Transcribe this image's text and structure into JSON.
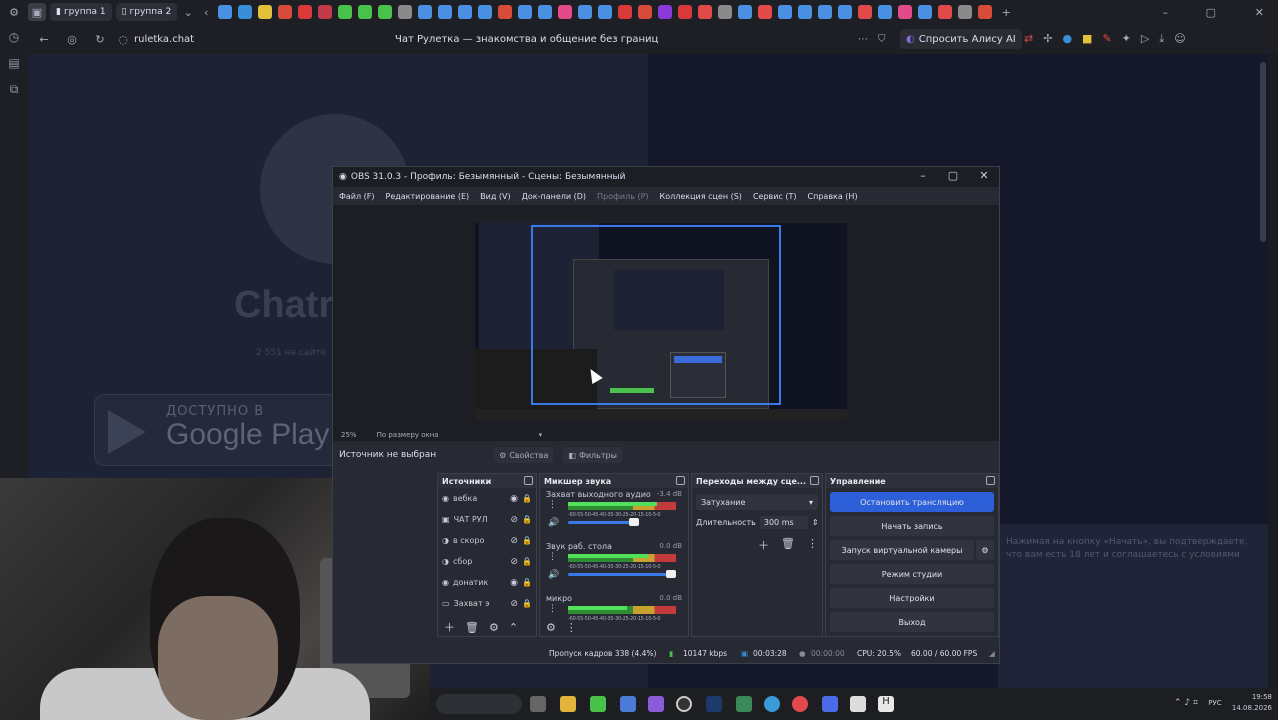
{
  "browser": {
    "tab_groups": [
      {
        "label": "группа 1"
      },
      {
        "label": "группа 2"
      }
    ],
    "url": "ruletka.chat",
    "page_title": "Чат Рулетка — знакомства и общение без границ",
    "alice_label": "Спросить Алису AI",
    "favicons": [
      "#4a90e2",
      "#3a8ed8",
      "#e2c23a",
      "#d84a3a",
      "#d83a3a",
      "#c23a4a",
      "#49c14b",
      "#49c14b",
      "#49c14b",
      "#8a8a8a",
      "#4a90e2",
      "#4a90e2",
      "#4a90e2",
      "#4a90e2",
      "#d84a3a",
      "#4a90e2",
      "#4a90e2",
      "#e24a8a",
      "#4a90e2",
      "#4a90e2",
      "#d83a3a",
      "#d84a3a",
      "#8a3ad8",
      "#d83a3a",
      "#e24a4a",
      "#8a8a8a",
      "#4a90e2",
      "#e24a4a",
      "#4a90e2",
      "#4a90e2",
      "#4a90e2",
      "#4a90e2",
      "#e24a4a",
      "#4a90e2",
      "#e24a8a",
      "#4a90e2",
      "#e24a4a",
      "#8a8a8a",
      "#d84a3a"
    ]
  },
  "page": {
    "brand": "Chatr",
    "online": "2 551 на сайте",
    "google_small": "ДОСТУПНО В",
    "google_big": "Google Play",
    "right_text": "Нажимая на кнопку «Начать», вы подтверждаете, что вам есть 18 лет и соглашаетесь с условиями"
  },
  "obs": {
    "title": "OBS 31.0.3 - Профиль: Безымянный - Сцены: Безымянный",
    "menu": [
      {
        "label": "Файл (F)",
        "disabled": false
      },
      {
        "label": "Редактирование (E)",
        "disabled": false
      },
      {
        "label": "Вид (V)",
        "disabled": false
      },
      {
        "label": "Док-панели (D)",
        "disabled": false
      },
      {
        "label": "Профиль (P)",
        "disabled": true
      },
      {
        "label": "Коллекция сцен (S)",
        "disabled": false
      },
      {
        "label": "Сервис (T)",
        "disabled": false
      },
      {
        "label": "Справка (H)",
        "disabled": false
      }
    ],
    "zoom": "25%",
    "zoom_mode": "По размеру окна",
    "no_source": "Источник не выбран",
    "properties": "Свойства",
    "filters": "Фильтры",
    "sources": {
      "title": "Источники",
      "items": [
        {
          "label": "вебка"
        },
        {
          "label": "ЧАТ РУЛ"
        },
        {
          "label": "в скоро"
        },
        {
          "label": "сбор"
        },
        {
          "label": "донатик"
        },
        {
          "label": "Захват э"
        }
      ]
    },
    "mixer": {
      "title": "Микшер звука",
      "channels": [
        {
          "name": "Захват выходного аудио",
          "db": "-3.4 dB",
          "level": 0.82,
          "volume": 0.66
        },
        {
          "name": "Звук раб. стола",
          "db": "0.0 dB",
          "level": 0.74,
          "volume": 1.0
        },
        {
          "name": "микро",
          "db": "0.0 dB",
          "level": 0.55,
          "volume": 1.0
        }
      ],
      "scale": "-60-55-50-45-40-35-30-25-20-15-10-5-0"
    },
    "transitions": {
      "title": "Переходы между сце...",
      "selected": "Затухание",
      "duration_label": "Длительность",
      "duration_value": "300 ms"
    },
    "controls": {
      "title": "Управление",
      "stop_stream": "Остановить трансляцию",
      "start_record": "Начать запись",
      "virtual_cam": "Запуск виртуальной камеры",
      "studio": "Режим студии",
      "settings": "Настройки",
      "exit": "Выход"
    },
    "status": {
      "dropped": "Пропуск кадров 338 (4.4%)",
      "bitrate": "10147 kbps",
      "stream_time": "00:03:28",
      "rec_time": "00:00:00",
      "cpu": "CPU: 20.5%",
      "fps": "60.00 / 60.00 FPS"
    }
  },
  "taskbar": {
    "lang": "РУС",
    "time": "19:58",
    "date": "14.08.2026"
  }
}
